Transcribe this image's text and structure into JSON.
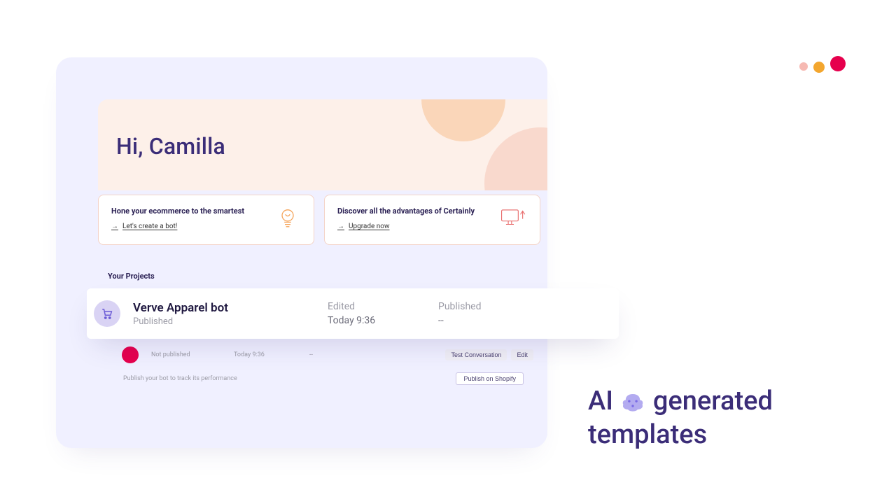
{
  "hero": {
    "greeting": "Hi, Camilla"
  },
  "promos": [
    {
      "title": "Hone your ecommerce to the smartest",
      "link": "Let's create a bot!"
    },
    {
      "title": "Discover all the advantages of Certainly",
      "link": "Upgrade now"
    }
  ],
  "section": {
    "projects_label": "Your Projects"
  },
  "project": {
    "name": "Verve Apparel bot",
    "status": "Published",
    "edited_label": "Edited",
    "edited_value": "Today 9:36",
    "published_label": "Published",
    "published_value": "--"
  },
  "list_row": {
    "status": "Not published",
    "edited": "Today 9:36",
    "published": "--",
    "actions": {
      "test": "Test Conversation",
      "edit": "Edit"
    }
  },
  "publish": {
    "hint": "Publish your bot to track its performance",
    "button": "Publish on Shopify"
  },
  "headline": {
    "pre": "AI",
    "mid": "generated",
    "post": "templates"
  }
}
